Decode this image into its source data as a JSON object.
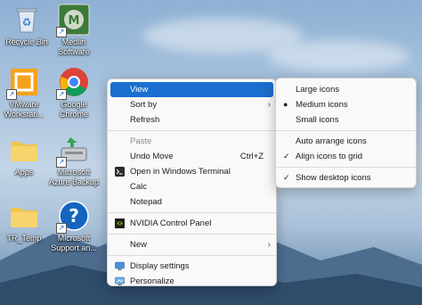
{
  "desktop": {
    "icons": [
      {
        "label": "Recycle Bin",
        "icon": "recycle-bin-icon"
      },
      {
        "label": "Medlin Software",
        "icon": "medlin-software-icon"
      },
      {
        "label": "VMware Workstati...",
        "icon": "vmware-icon"
      },
      {
        "label": "Google Chrome",
        "icon": "chrome-icon"
      },
      {
        "label": "Apps",
        "icon": "folder-icon"
      },
      {
        "label": "Microsoft Azure Backup",
        "icon": "azure-backup-icon"
      },
      {
        "label": "TR_Temp",
        "icon": "folder-icon"
      },
      {
        "label": "Microsoft Support an...",
        "icon": "help-icon"
      }
    ]
  },
  "context_menu": {
    "items": {
      "view": "View",
      "sort_by": "Sort by",
      "refresh": "Refresh",
      "paste": "Paste",
      "undo_move": "Undo Move",
      "undo_move_shortcut": "Ctrl+Z",
      "open_terminal": "Open in Windows Terminal",
      "calc": "Calc",
      "notepad": "Notepad",
      "nvidia": "NVIDIA Control Panel",
      "new": "New",
      "display_settings": "Display settings",
      "personalize": "Personalize"
    }
  },
  "view_submenu": {
    "items": {
      "large_icons": "Large icons",
      "medium_icons": "Medium icons",
      "small_icons": "Small icons",
      "auto_arrange": "Auto arrange icons",
      "align_grid": "Align icons to grid",
      "show_desktop_icons": "Show desktop icons"
    },
    "selected_size": "Medium icons",
    "checked": [
      "Align icons to grid",
      "Show desktop icons"
    ]
  },
  "colors": {
    "highlight": "#1a6fd1",
    "menu_bg": "#f9f9f9"
  }
}
